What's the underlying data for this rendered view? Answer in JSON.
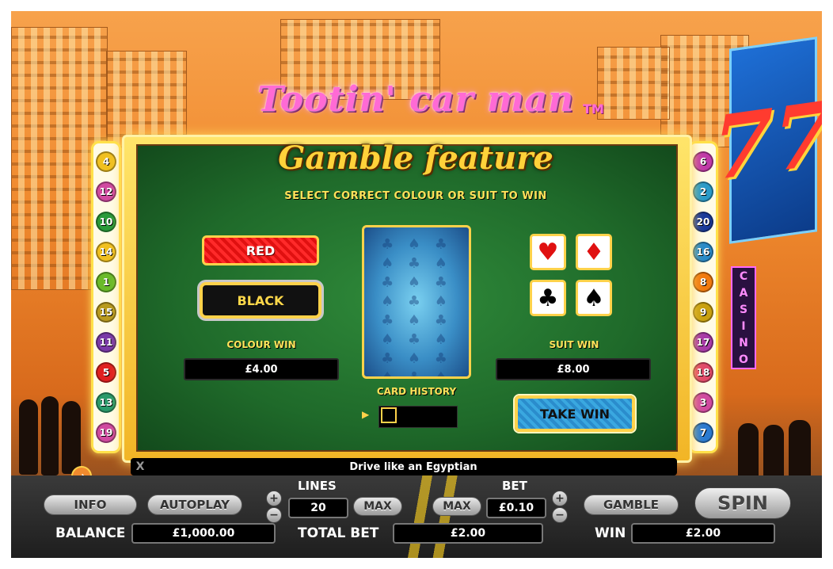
{
  "game_title": "Tootin' car man",
  "trademark": "TM",
  "feature_title": "Gamble feature",
  "instruction": "SELECT CORRECT COLOUR OR SUIT TO WIN",
  "left_numbers": [
    "4",
    "12",
    "10",
    "14",
    "1",
    "15",
    "11",
    "5",
    "13",
    "19"
  ],
  "right_numbers": [
    "6",
    "2",
    "20",
    "16",
    "8",
    "9",
    "17",
    "18",
    "3",
    "7"
  ],
  "left_ball_colors": [
    "#f0c020",
    "#d04aa0",
    "#2a9a3a",
    "#f0c020",
    "#6aba2a",
    "#b89a20",
    "#7a3aa8",
    "#e02020",
    "#2a9a6a",
    "#d04aa0"
  ],
  "right_ball_colors": [
    "#c03aa8",
    "#2a9ac8",
    "#1a3a9a",
    "#2a8ac8",
    "#f07a10",
    "#c8a010",
    "#a83aa8",
    "#e04a6a",
    "#d04aa0",
    "#2a7ad0"
  ],
  "colour_buttons": {
    "red": "RED",
    "black": "BLACK"
  },
  "colour_win": {
    "label": "COLOUR WIN",
    "value": "£4.00"
  },
  "suit_win": {
    "label": "SUIT WIN",
    "value": "£8.00"
  },
  "suits": {
    "hearts": "♥",
    "diamonds": "♦",
    "clubs": "♣",
    "spades": "♠"
  },
  "card_pattern": "♣ ♠ ♣ ♠ ♣ ♠ ♣ ♠ ♣ ♠ ♣ ♠ ♣ ♠ ♣ ♠ ♣ ♠ ♣ ♠ ♣ ♠ ♣ ♠ ♣ ♠ ♣ ♠ ♣ ♠",
  "card_history_label": "CARD HISTORY",
  "take_win": "TAKE WIN",
  "message": {
    "close": "X",
    "text": "Drive like an Egyptian"
  },
  "casino_sign": [
    "C",
    "A",
    "S",
    "I",
    "N",
    "O"
  ],
  "controls": {
    "info": "INFO",
    "autoplay": "AUTOPLAY",
    "lines_label": "LINES",
    "lines_value": "20",
    "max": "MAX",
    "bet_label": "BET",
    "bet_value": "£0.10",
    "plus": "+",
    "minus": "−",
    "gamble": "GAMBLE",
    "spin": "SPIN",
    "balance_label": "BALANCE",
    "balance_value": "£1,000.00",
    "total_bet_label": "TOTAL BET",
    "total_bet_value": "£2.00",
    "win_label": "WIN",
    "win_value": "£2.00"
  }
}
